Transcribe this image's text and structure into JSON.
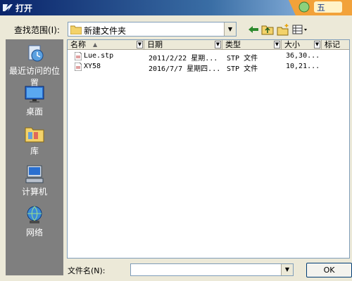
{
  "window": {
    "title": "打开",
    "title_icon": "app-logo-icon",
    "decoration_text": "五"
  },
  "lookin": {
    "label": "查找范围(I):",
    "value": "新建文件夹"
  },
  "toolbar": {
    "back_icon": "back-arrow-icon",
    "up_icon": "up-folder-icon",
    "new_folder_icon": "new-folder-icon",
    "views_icon": "views-menu-icon"
  },
  "places": [
    {
      "label": "最近访问的位置",
      "line1": "最近访问的位",
      "line2": "置",
      "icon": "recent-places-icon"
    },
    {
      "label": "桌面",
      "icon": "desktop-icon"
    },
    {
      "label": "库",
      "icon": "libraries-icon"
    },
    {
      "label": "计算机",
      "icon": "computer-icon"
    },
    {
      "label": "网络",
      "icon": "network-icon"
    }
  ],
  "columns": [
    {
      "label": "名称",
      "sort_indicator": "▲"
    },
    {
      "label": "日期"
    },
    {
      "label": "类型"
    },
    {
      "label": "大小"
    },
    {
      "label": "标记"
    }
  ],
  "files": [
    {
      "name": "Lue.stp",
      "date": "2011/2/22 星期...",
      "type": "STP 文件",
      "size": "36,30..."
    },
    {
      "name": "XY58",
      "date": "2016/7/7 星期四...",
      "type": "STP 文件",
      "size": "10,21..."
    }
  ],
  "filename": {
    "label": "文件名(N):",
    "value": ""
  },
  "ok_button": {
    "label": "OK"
  },
  "colors": {
    "title_bar": "#0a246a",
    "places_bar": "#7f7f7f",
    "dialog_bg": "#ece9d8"
  }
}
